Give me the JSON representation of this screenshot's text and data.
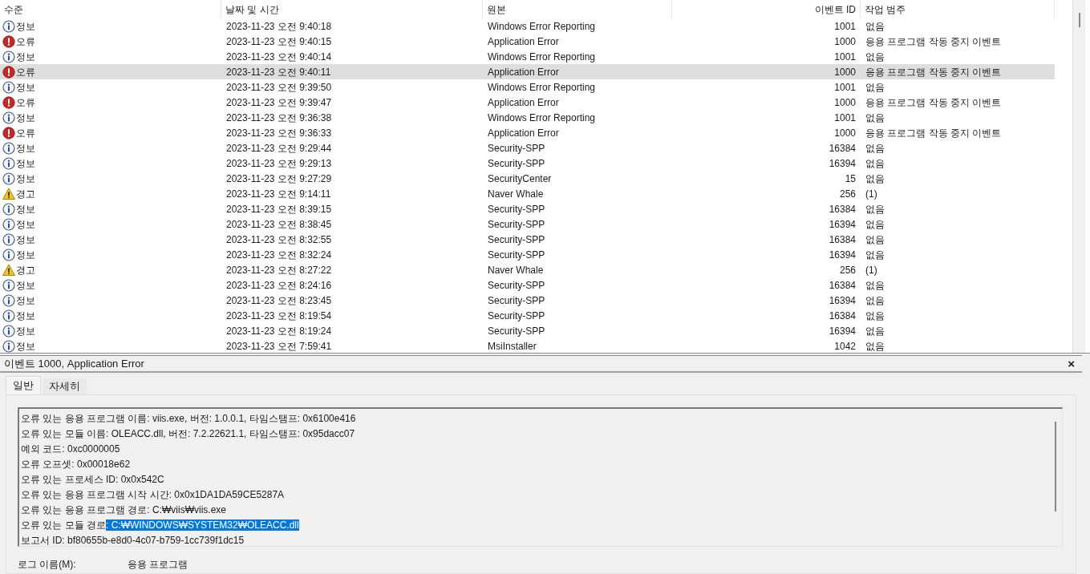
{
  "columns": [
    {
      "label": "수준"
    },
    {
      "label": "날짜 및 시간"
    },
    {
      "label": "원본"
    },
    {
      "label": "이벤트 ID"
    },
    {
      "label": "작업 범주"
    }
  ],
  "rows": [
    {
      "kind": "info",
      "level": "정보",
      "date": "2023-11-23 오전 9:40:18",
      "source": "Windows Error Reporting",
      "id": "1001",
      "category": "없음",
      "selected": false
    },
    {
      "kind": "error",
      "level": "오류",
      "date": "2023-11-23 오전 9:40:15",
      "source": "Application Error",
      "id": "1000",
      "category": "응용 프로그램 작동 중지 이벤트",
      "selected": false
    },
    {
      "kind": "info",
      "level": "정보",
      "date": "2023-11-23 오전 9:40:14",
      "source": "Windows Error Reporting",
      "id": "1001",
      "category": "없음",
      "selected": false
    },
    {
      "kind": "error",
      "level": "오류",
      "date": "2023-11-23 오전 9:40:11",
      "source": "Application Error",
      "id": "1000",
      "category": "응용 프로그램 작동 중지 이벤트",
      "selected": true
    },
    {
      "kind": "info",
      "level": "정보",
      "date": "2023-11-23 오전 9:39:50",
      "source": "Windows Error Reporting",
      "id": "1001",
      "category": "없음",
      "selected": false
    },
    {
      "kind": "error",
      "level": "오류",
      "date": "2023-11-23 오전 9:39:47",
      "source": "Application Error",
      "id": "1000",
      "category": "응용 프로그램 작동 중지 이벤트",
      "selected": false
    },
    {
      "kind": "info",
      "level": "정보",
      "date": "2023-11-23 오전 9:36:38",
      "source": "Windows Error Reporting",
      "id": "1001",
      "category": "없음",
      "selected": false
    },
    {
      "kind": "error",
      "level": "오류",
      "date": "2023-11-23 오전 9:36:33",
      "source": "Application Error",
      "id": "1000",
      "category": "응용 프로그램 작동 중지 이벤트",
      "selected": false
    },
    {
      "kind": "info",
      "level": "정보",
      "date": "2023-11-23 오전 9:29:44",
      "source": "Security-SPP",
      "id": "16384",
      "category": "없음",
      "selected": false
    },
    {
      "kind": "info",
      "level": "정보",
      "date": "2023-11-23 오전 9:29:13",
      "source": "Security-SPP",
      "id": "16394",
      "category": "없음",
      "selected": false
    },
    {
      "kind": "info",
      "level": "정보",
      "date": "2023-11-23 오전 9:27:29",
      "source": "SecurityCenter",
      "id": "15",
      "category": "없음",
      "selected": false
    },
    {
      "kind": "warning",
      "level": "경고",
      "date": "2023-11-23 오전 9:14:11",
      "source": "Naver Whale",
      "id": "256",
      "category": "(1)",
      "selected": false
    },
    {
      "kind": "info",
      "level": "정보",
      "date": "2023-11-23 오전 8:39:15",
      "source": "Security-SPP",
      "id": "16384",
      "category": "없음",
      "selected": false
    },
    {
      "kind": "info",
      "level": "정보",
      "date": "2023-11-23 오전 8:38:45",
      "source": "Security-SPP",
      "id": "16394",
      "category": "없음",
      "selected": false
    },
    {
      "kind": "info",
      "level": "정보",
      "date": "2023-11-23 오전 8:32:55",
      "source": "Security-SPP",
      "id": "16384",
      "category": "없음",
      "selected": false
    },
    {
      "kind": "info",
      "level": "정보",
      "date": "2023-11-23 오전 8:32:24",
      "source": "Security-SPP",
      "id": "16394",
      "category": "없음",
      "selected": false
    },
    {
      "kind": "warning",
      "level": "경고",
      "date": "2023-11-23 오전 8:27:22",
      "source": "Naver Whale",
      "id": "256",
      "category": "(1)",
      "selected": false
    },
    {
      "kind": "info",
      "level": "정보",
      "date": "2023-11-23 오전 8:24:16",
      "source": "Security-SPP",
      "id": "16384",
      "category": "없음",
      "selected": false
    },
    {
      "kind": "info",
      "level": "정보",
      "date": "2023-11-23 오전 8:23:45",
      "source": "Security-SPP",
      "id": "16394",
      "category": "없음",
      "selected": false
    },
    {
      "kind": "info",
      "level": "정보",
      "date": "2023-11-23 오전 8:19:54",
      "source": "Security-SPP",
      "id": "16384",
      "category": "없음",
      "selected": false
    },
    {
      "kind": "info",
      "level": "정보",
      "date": "2023-11-23 오전 8:19:24",
      "source": "Security-SPP",
      "id": "16394",
      "category": "없음",
      "selected": false
    },
    {
      "kind": "info",
      "level": "정보",
      "date": "2023-11-23 오전 7:59:41",
      "source": "MsiInstaller",
      "id": "1042",
      "category": "없음",
      "selected": false
    }
  ],
  "detail": {
    "title": "이벤트 1000, Application Error",
    "close": "×",
    "tabs": [
      {
        "label": "일반",
        "selected": true
      },
      {
        "label": "자세히",
        "selected": false
      }
    ],
    "lines": [
      {
        "text": "오류 있는 응용 프로그램 이름: viis.exe, 버전: 1.0.0.1, 타임스탬프: 0x6100e416"
      },
      {
        "text": "오류 있는 모듈 이름: OLEACC.dll, 버전: 7.2.22621.1, 타임스탬프: 0x95dacc07"
      },
      {
        "text": "예외 코드: 0xc0000005"
      },
      {
        "text": "오류 오프셋: 0x00018e62"
      },
      {
        "text": "오류 있는 프로세스 ID: 0x0x542C"
      },
      {
        "text": "오류 있는 응용 프로그램 시작 시간: 0x0x1DA1DA59CE5287A"
      },
      {
        "text": "오류 있는 응용 프로그램 경로: C:₩viis₩viis.exe"
      },
      {
        "text": "오류 있는 모듈 경로",
        "selection": ": C:₩WINDOWS₩SYSTEM32₩OLEACC.dll"
      },
      {
        "text": "보고서 ID: bf80655b-e8d0-4c07-b759-1cc739f1dc15"
      }
    ],
    "field": {
      "label": "로그 이름(M):",
      "value": "응용 프로그램"
    }
  }
}
